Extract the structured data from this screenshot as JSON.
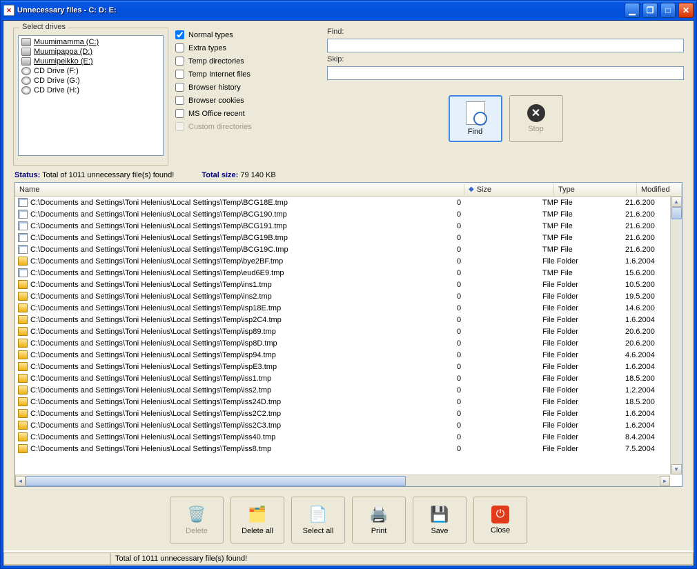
{
  "window": {
    "title": "Unnecessary files - C: D: E:"
  },
  "drives": {
    "legend": "Select drives",
    "items": [
      {
        "label": "Muumimamma (C:)",
        "kind": "hdd",
        "selected": true
      },
      {
        "label": "Muumipappa (D:)",
        "kind": "hdd",
        "selected": true
      },
      {
        "label": "Muumipeikko (E:)",
        "kind": "hdd",
        "selected": true
      },
      {
        "label": "CD Drive (F:)",
        "kind": "cd",
        "selected": false
      },
      {
        "label": "CD Drive (G:)",
        "kind": "cd",
        "selected": false
      },
      {
        "label": "CD Drive (H:)",
        "kind": "cd",
        "selected": false
      }
    ]
  },
  "types": [
    {
      "label": "Normal types",
      "checked": true,
      "disabled": false
    },
    {
      "label": "Extra types",
      "checked": false,
      "disabled": false
    },
    {
      "label": "Temp directories",
      "checked": false,
      "disabled": false
    },
    {
      "label": "Temp Internet files",
      "checked": false,
      "disabled": false
    },
    {
      "label": "Browser history",
      "checked": false,
      "disabled": false
    },
    {
      "label": "Browser cookies",
      "checked": false,
      "disabled": false
    },
    {
      "label": "MS Office recent",
      "checked": false,
      "disabled": false
    },
    {
      "label": "Custom directories",
      "checked": false,
      "disabled": true
    }
  ],
  "search": {
    "find_label": "Find:",
    "skip_label": "Skip:",
    "find_value": "",
    "skip_value": "",
    "find_btn": "Find",
    "stop_btn": "Stop"
  },
  "status": {
    "status_label": "Status:",
    "status_text": "Total of 1011 unnecessary file(s) found!",
    "size_label": "Total size:",
    "size_text": "79 140 KB"
  },
  "columns": {
    "name": "Name",
    "size": "Size",
    "type": "Type",
    "modified": "Modified"
  },
  "rows": [
    {
      "icon": "file",
      "name": "C:\\Documents and Settings\\Toni Helenius\\Local Settings\\Temp\\BCG18E.tmp",
      "size": "0",
      "type": "TMP File",
      "modified": "21.6.200"
    },
    {
      "icon": "file",
      "name": "C:\\Documents and Settings\\Toni Helenius\\Local Settings\\Temp\\BCG190.tmp",
      "size": "0",
      "type": "TMP File",
      "modified": "21.6.200"
    },
    {
      "icon": "file",
      "name": "C:\\Documents and Settings\\Toni Helenius\\Local Settings\\Temp\\BCG191.tmp",
      "size": "0",
      "type": "TMP File",
      "modified": "21.6.200"
    },
    {
      "icon": "file",
      "name": "C:\\Documents and Settings\\Toni Helenius\\Local Settings\\Temp\\BCG19B.tmp",
      "size": "0",
      "type": "TMP File",
      "modified": "21.6.200"
    },
    {
      "icon": "file",
      "name": "C:\\Documents and Settings\\Toni Helenius\\Local Settings\\Temp\\BCG19C.tmp",
      "size": "0",
      "type": "TMP File",
      "modified": "21.6.200"
    },
    {
      "icon": "folder",
      "name": "C:\\Documents and Settings\\Toni Helenius\\Local Settings\\Temp\\bye2BF.tmp",
      "size": "0",
      "type": "File Folder",
      "modified": "1.6.2004"
    },
    {
      "icon": "file",
      "name": "C:\\Documents and Settings\\Toni Helenius\\Local Settings\\Temp\\eud6E9.tmp",
      "size": "0",
      "type": "TMP File",
      "modified": "15.6.200"
    },
    {
      "icon": "folder",
      "name": "C:\\Documents and Settings\\Toni Helenius\\Local Settings\\Temp\\ins1.tmp",
      "size": "0",
      "type": "File Folder",
      "modified": "10.5.200"
    },
    {
      "icon": "folder",
      "name": "C:\\Documents and Settings\\Toni Helenius\\Local Settings\\Temp\\ins2.tmp",
      "size": "0",
      "type": "File Folder",
      "modified": "19.5.200"
    },
    {
      "icon": "folder",
      "name": "C:\\Documents and Settings\\Toni Helenius\\Local Settings\\Temp\\isp18E.tmp",
      "size": "0",
      "type": "File Folder",
      "modified": "14.6.200"
    },
    {
      "icon": "folder",
      "name": "C:\\Documents and Settings\\Toni Helenius\\Local Settings\\Temp\\isp2C4.tmp",
      "size": "0",
      "type": "File Folder",
      "modified": "1.6.2004"
    },
    {
      "icon": "folder",
      "name": "C:\\Documents and Settings\\Toni Helenius\\Local Settings\\Temp\\isp89.tmp",
      "size": "0",
      "type": "File Folder",
      "modified": "20.6.200"
    },
    {
      "icon": "folder",
      "name": "C:\\Documents and Settings\\Toni Helenius\\Local Settings\\Temp\\isp8D.tmp",
      "size": "0",
      "type": "File Folder",
      "modified": "20.6.200"
    },
    {
      "icon": "folder",
      "name": "C:\\Documents and Settings\\Toni Helenius\\Local Settings\\Temp\\isp94.tmp",
      "size": "0",
      "type": "File Folder",
      "modified": "4.6.2004"
    },
    {
      "icon": "folder",
      "name": "C:\\Documents and Settings\\Toni Helenius\\Local Settings\\Temp\\ispE3.tmp",
      "size": "0",
      "type": "File Folder",
      "modified": "1.6.2004"
    },
    {
      "icon": "folder",
      "name": "C:\\Documents and Settings\\Toni Helenius\\Local Settings\\Temp\\iss1.tmp",
      "size": "0",
      "type": "File Folder",
      "modified": "18.5.200"
    },
    {
      "icon": "folder",
      "name": "C:\\Documents and Settings\\Toni Helenius\\Local Settings\\Temp\\iss2.tmp",
      "size": "0",
      "type": "File Folder",
      "modified": "1.2.2004"
    },
    {
      "icon": "folder",
      "name": "C:\\Documents and Settings\\Toni Helenius\\Local Settings\\Temp\\iss24D.tmp",
      "size": "0",
      "type": "File Folder",
      "modified": "18.5.200"
    },
    {
      "icon": "folder",
      "name": "C:\\Documents and Settings\\Toni Helenius\\Local Settings\\Temp\\iss2C2.tmp",
      "size": "0",
      "type": "File Folder",
      "modified": "1.6.2004"
    },
    {
      "icon": "folder",
      "name": "C:\\Documents and Settings\\Toni Helenius\\Local Settings\\Temp\\iss2C3.tmp",
      "size": "0",
      "type": "File Folder",
      "modified": "1.6.2004"
    },
    {
      "icon": "folder",
      "name": "C:\\Documents and Settings\\Toni Helenius\\Local Settings\\Temp\\iss40.tmp",
      "size": "0",
      "type": "File Folder",
      "modified": "8.4.2004"
    },
    {
      "icon": "folder",
      "name": "C:\\Documents and Settings\\Toni Helenius\\Local Settings\\Temp\\iss8.tmp",
      "size": "0",
      "type": "File Folder",
      "modified": "7.5.2004"
    }
  ],
  "toolbar": {
    "delete": "Delete",
    "delete_all": "Delete all",
    "select_all": "Select all",
    "print": "Print",
    "save": "Save",
    "close": "Close"
  },
  "statusbar": {
    "text": "Total of 1011 unnecessary file(s) found!"
  }
}
